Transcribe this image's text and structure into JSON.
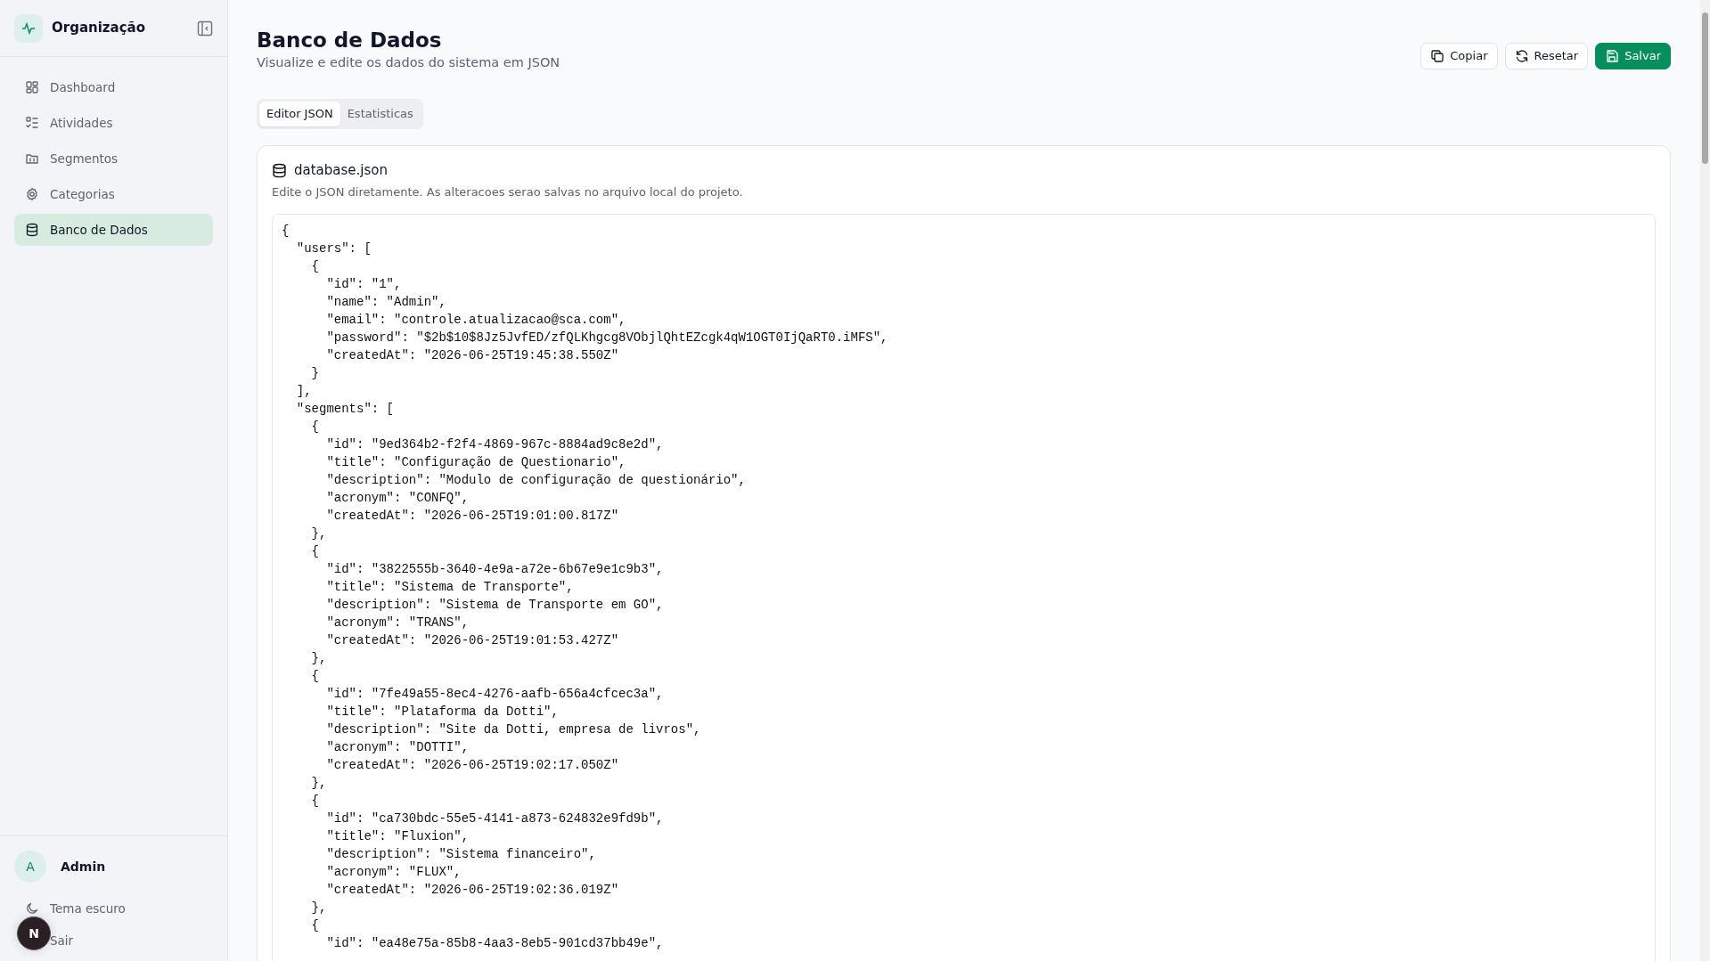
{
  "sidebar": {
    "brand": "Organização",
    "items": [
      {
        "label": "Dashboard",
        "selected": false
      },
      {
        "label": "Atividades",
        "selected": false
      },
      {
        "label": "Segmentos",
        "selected": false
      },
      {
        "label": "Categorias",
        "selected": false
      },
      {
        "label": "Banco de Dados",
        "selected": true
      }
    ],
    "user": {
      "initial": "A",
      "name": "Admin"
    },
    "footer_links": [
      {
        "label": "Tema escuro"
      },
      {
        "label": "Sair"
      }
    ]
  },
  "dev_badge": {
    "label": "N"
  },
  "header": {
    "title": "Banco de Dados",
    "subtitle": "Visualize e edite os dados do sistema em JSON",
    "buttons": [
      {
        "label": "Copiar",
        "kind": "outline"
      },
      {
        "label": "Resetar",
        "kind": "outline"
      },
      {
        "label": "Salvar",
        "kind": "primary"
      }
    ]
  },
  "tabs": [
    {
      "label": "Editor JSON",
      "selected": true
    },
    {
      "label": "Estatisticas",
      "selected": false
    }
  ],
  "card": {
    "title": "database.json",
    "description": "Edite o JSON diretamente. As alteracoes serao salvas no arquivo local do projeto.",
    "editor_lines": [
      "{",
      "  \"users\": [",
      "    {",
      "      \"id\": \"1\",",
      "      \"name\": \"Admin\",",
      "      \"email\": \"controle.atualizacao@sca.com\",",
      "      \"password\": \"$2b$10$8Jz5JvfED/zfQLKhgcg8VObjlQhtEZcgk4qW1OGT0IjQaRT0.iMFS\",",
      "      \"createdAt\": \"2026-06-25T19:45:38.550Z\"",
      "    }",
      "  ],",
      "  \"segments\": [",
      "    {",
      "      \"id\": \"9ed364b2-f2f4-4869-967c-8884ad9c8e2d\",",
      "      \"title\": \"Configuração de Questionario\",",
      "      \"description\": \"Modulo de configuração de questionário\",",
      "      \"acronym\": \"CONFQ\",",
      "      \"createdAt\": \"2026-06-25T19:01:00.817Z\"",
      "    },",
      "    {",
      "      \"id\": \"3822555b-3640-4e9a-a72e-6b67e9e1c9b3\",",
      "      \"title\": \"Sistema de Transporte\",",
      "      \"description\": \"Sistema de Transporte em GO\",",
      "      \"acronym\": \"TRANS\",",
      "      \"createdAt\": \"2026-06-25T19:01:53.427Z\"",
      "    },",
      "    {",
      "      \"id\": \"7fe49a55-8ec4-4276-aafb-656a4cfcec3a\",",
      "      \"title\": \"Plataforma da Dotti\",",
      "      \"description\": \"Site da Dotti, empresa de livros\",",
      "      \"acronym\": \"DOTTI\",",
      "      \"createdAt\": \"2026-06-25T19:02:17.050Z\"",
      "    },",
      "    {",
      "      \"id\": \"ca730bdc-55e5-4141-a873-624832e9fd9b\",",
      "      \"title\": \"Fluxion\",",
      "      \"description\": \"Sistema financeiro\",",
      "      \"acronym\": \"FLUX\",",
      "      \"createdAt\": \"2026-06-25T19:02:36.019Z\"",
      "    },",
      "    {",
      "      \"id\": \"ea48e75a-85b8-4aa3-8eb5-901cd37bb49e\","
    ]
  }
}
